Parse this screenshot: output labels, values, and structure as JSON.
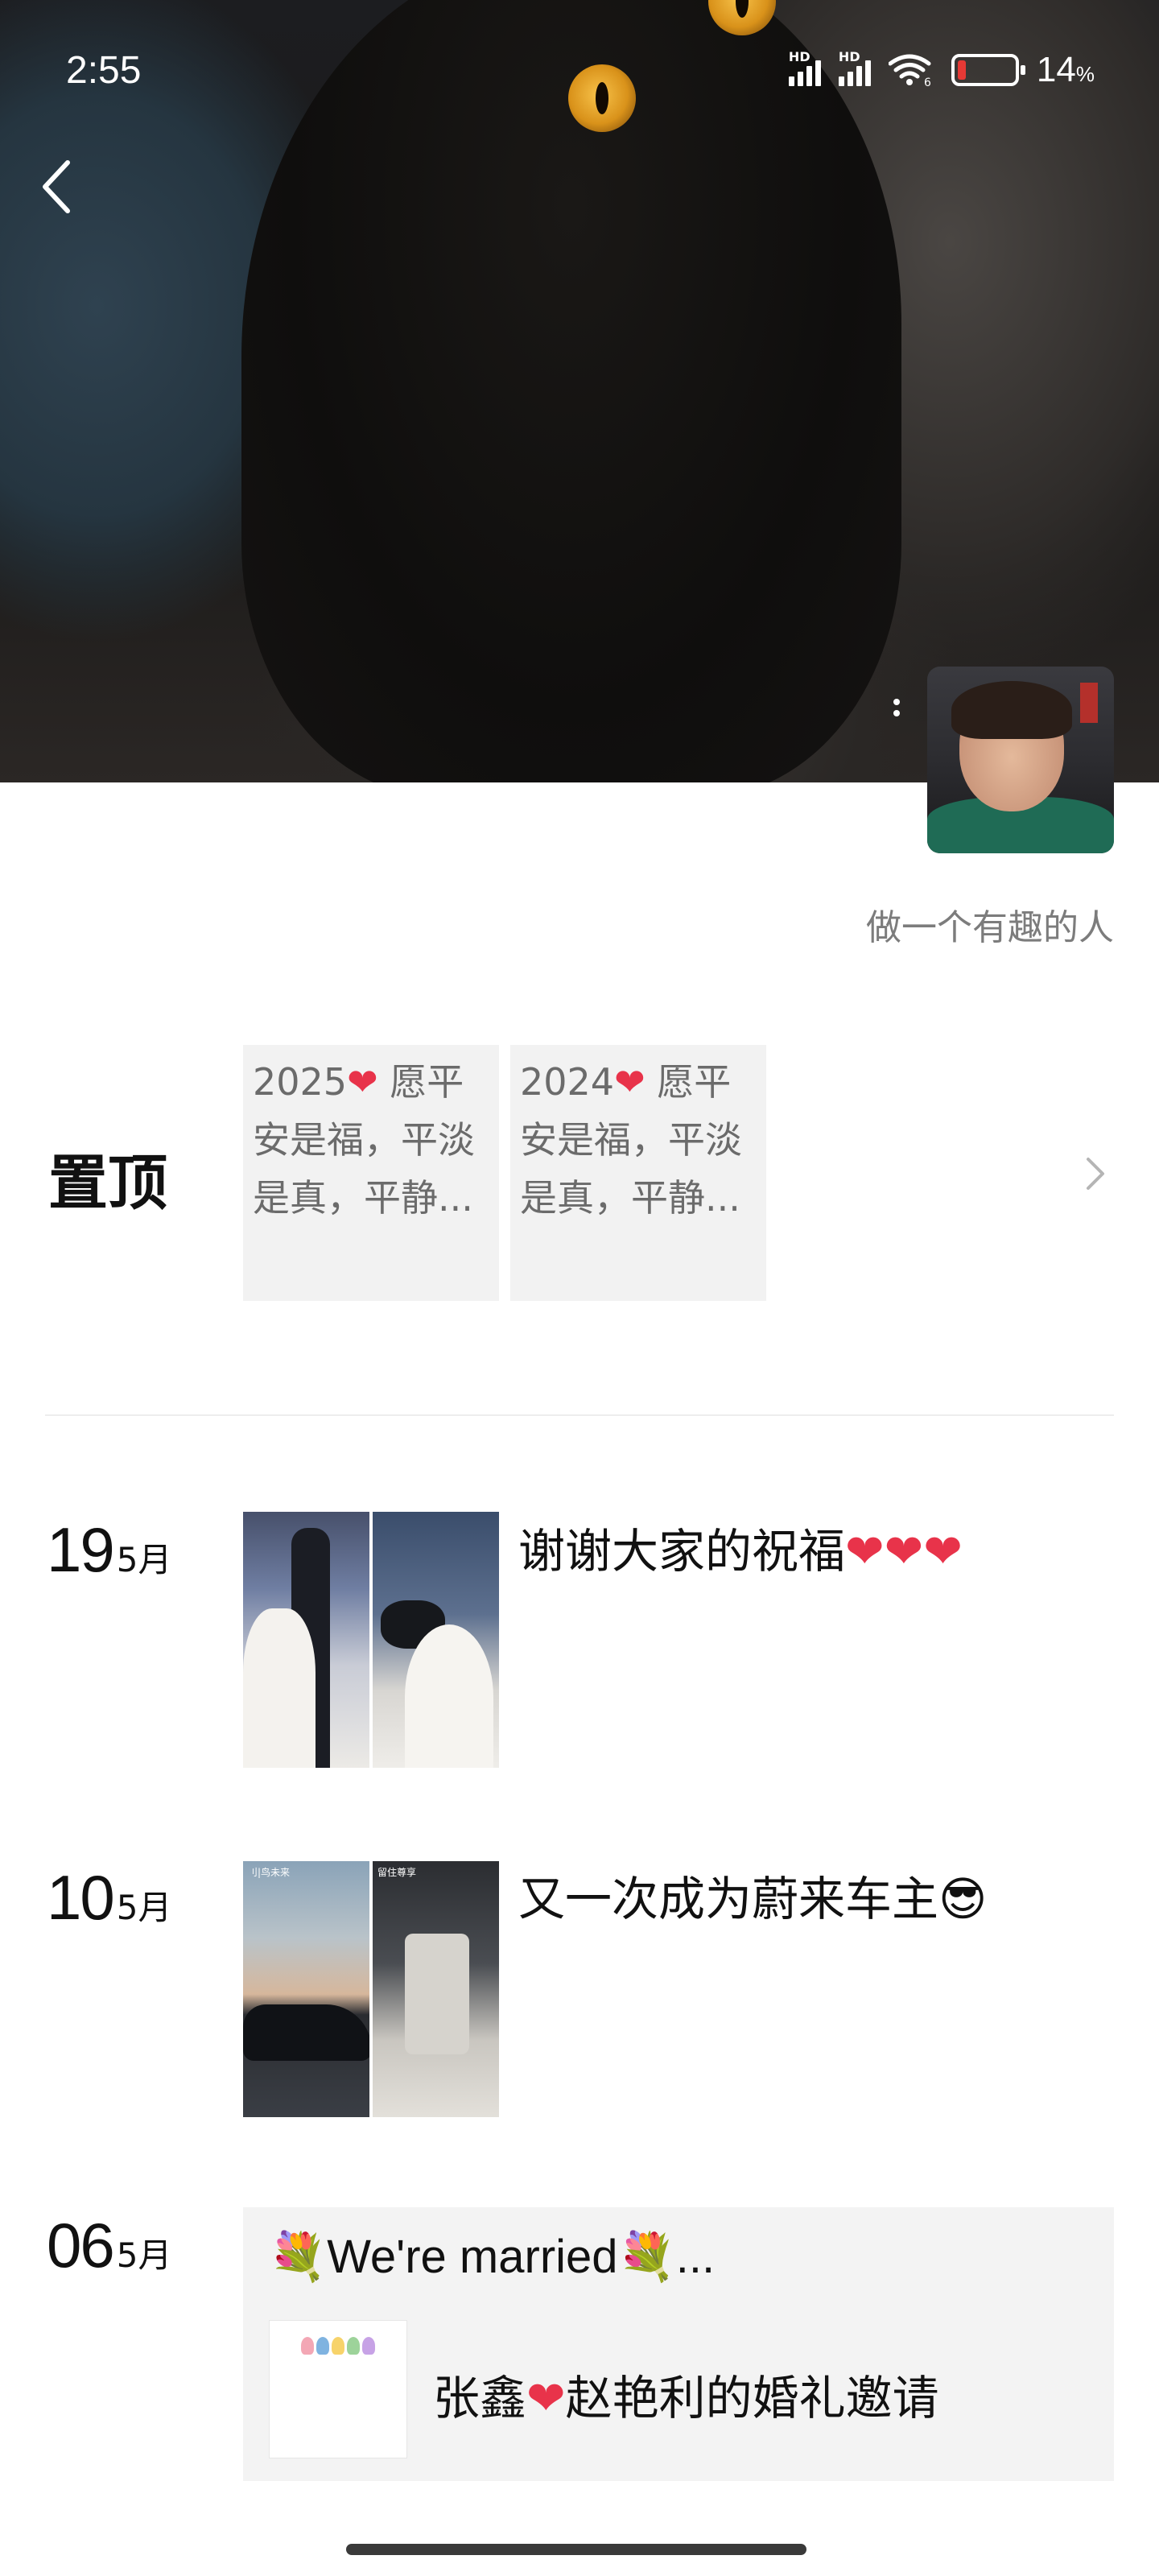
{
  "status_bar": {
    "time": "2:55",
    "signal_1_label": "HD",
    "signal_2_label": "HD",
    "wifi_badge": "6",
    "battery_percent": "14",
    "battery_unit": "%",
    "battery_level": 0.14
  },
  "profile": {
    "signature": "做一个有趣的人"
  },
  "pinned": {
    "label": "置顶",
    "cards": [
      {
        "year": "2025",
        "text": " 愿平安是福，平淡是真，平静..."
      },
      {
        "year": "2024",
        "text": " 愿平安是福，平淡是真，平静..."
      }
    ]
  },
  "posts": [
    {
      "day": "19",
      "month": "5月",
      "text": "谢谢大家的祝福",
      "hearts": "❤❤❤",
      "image_caption": ""
    },
    {
      "day": "10",
      "month": "5月",
      "text": "又一次成为蔚来车主",
      "emoji": "😎",
      "captions": [
        "刂|鸟未来",
        "留住尊享"
      ]
    },
    {
      "day": "06",
      "month": "5月"
    }
  ],
  "share_card": {
    "title": "We're married",
    "title_ellipsis": "...",
    "flower": "💐",
    "name_left": "张鑫",
    "name_right": "赵艳利的婚礼邀请",
    "heart": "❤"
  },
  "colors": {
    "heart": "#e8334a",
    "battery_low": "#e53935",
    "card_bg": "#f2f2f2",
    "secondary_text": "#7c7c7c"
  },
  "icons": [
    "back-arrow-icon",
    "more-vertical-icon",
    "chevron-right-icon",
    "wifi-icon",
    "battery-icon",
    "signal-icon"
  ]
}
